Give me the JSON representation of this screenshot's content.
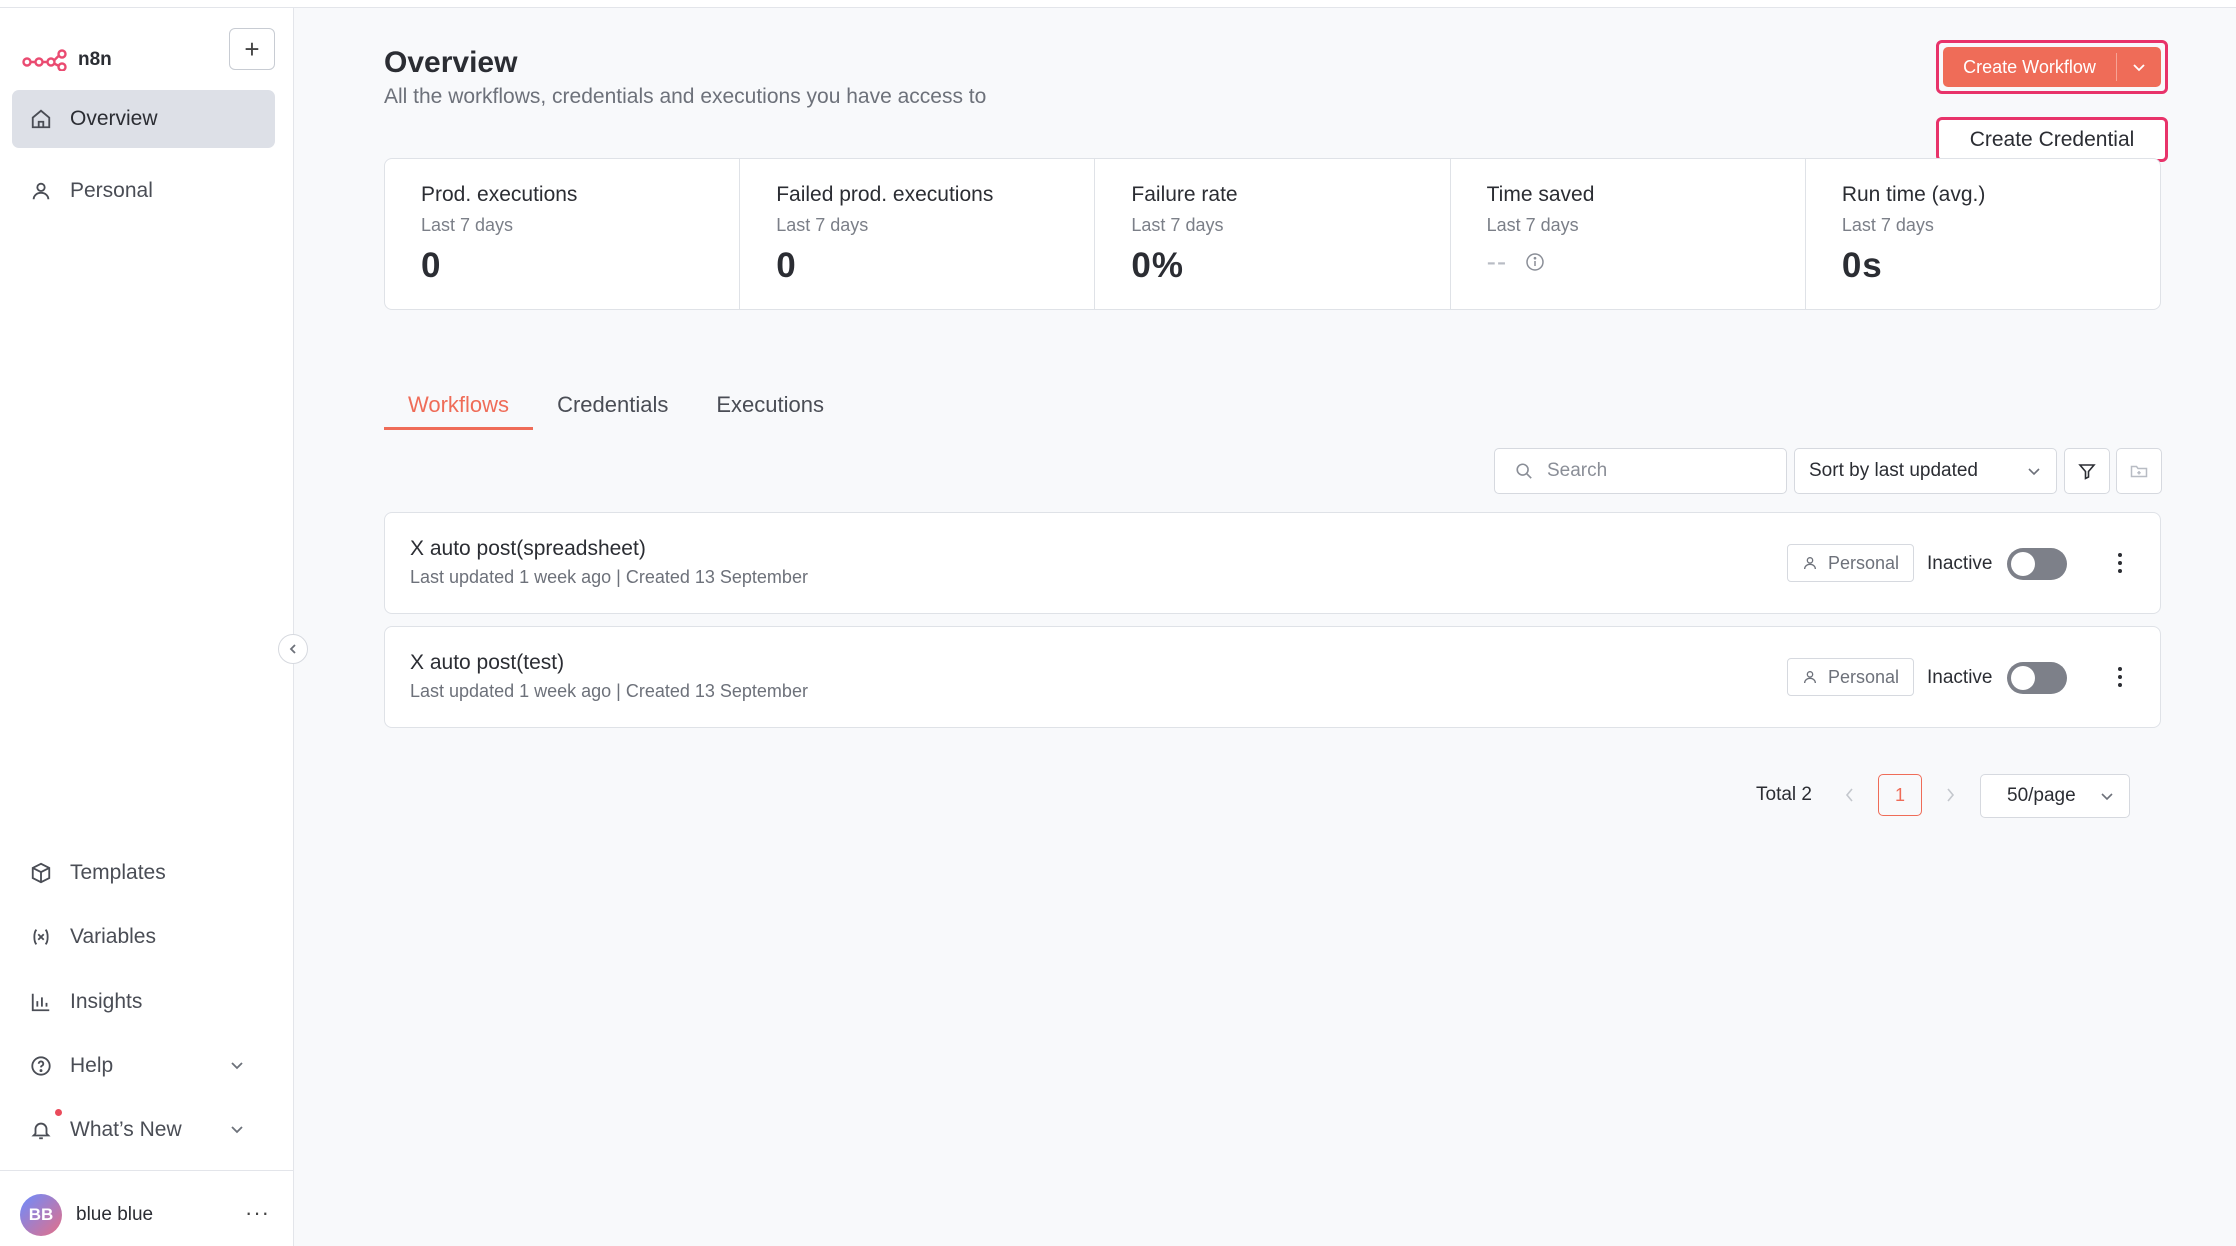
{
  "brand": {
    "name": "n8n"
  },
  "sidebar": {
    "top_items": [
      {
        "label": "Overview",
        "icon": "home-icon",
        "active": true
      },
      {
        "label": "Personal",
        "icon": "user-icon",
        "active": false
      }
    ],
    "bottom_items": [
      {
        "label": "Templates",
        "icon": "box-icon"
      },
      {
        "label": "Variables",
        "icon": "variable-icon"
      },
      {
        "label": "Insights",
        "icon": "chart-icon"
      },
      {
        "label": "Help",
        "icon": "help-icon"
      },
      {
        "label": "What’s New",
        "icon": "bell-icon"
      }
    ],
    "user": {
      "initials": "BB",
      "name": "blue blue",
      "menu": "···"
    }
  },
  "header": {
    "title": "Overview",
    "subtitle": "All the workflows, credentials and executions you have access to",
    "create_button": "Create Workflow",
    "dropdown_item": "Create Credential"
  },
  "stats": [
    {
      "label": "Prod. executions",
      "period": "Last 7 days",
      "value": "0"
    },
    {
      "label": "Failed prod. executions",
      "period": "Last 7 days",
      "value": "0"
    },
    {
      "label": "Failure rate",
      "period": "Last 7 days",
      "value": "0%"
    },
    {
      "label": "Time saved",
      "period": "Last 7 days",
      "value": "--"
    },
    {
      "label": "Run time (avg.)",
      "period": "Last 7 days",
      "value": "0s"
    }
  ],
  "tabs": [
    "Workflows",
    "Credentials",
    "Executions"
  ],
  "toolbar": {
    "search_placeholder": "Search",
    "sort_label": "Sort by last updated"
  },
  "workflows": [
    {
      "name": "X auto post(spreadsheet)",
      "meta": "Last updated 1 week ago | Created 13 September",
      "owner": "Personal",
      "status": "Inactive",
      "active": false
    },
    {
      "name": "X auto post(test)",
      "meta": "Last updated 1 week ago | Created 13 September",
      "owner": "Personal",
      "status": "Inactive",
      "active": false
    }
  ],
  "pagination": {
    "total": "Total 2",
    "current_page": "1",
    "page_size": "50/page"
  },
  "colors": {
    "accent": "#ef6c58",
    "highlight": "#e8336a",
    "brand_logo": "#ea4b71"
  }
}
